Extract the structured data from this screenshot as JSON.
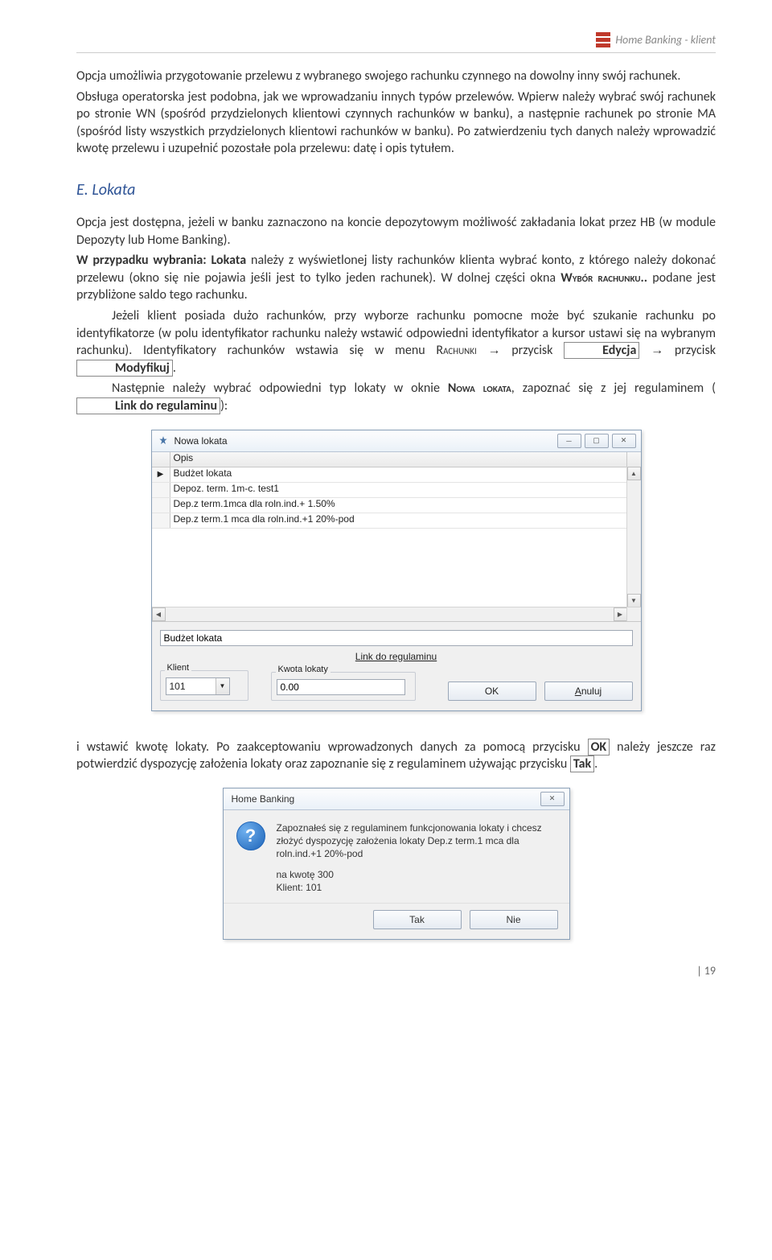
{
  "header": {
    "title": "Home Banking - klient"
  },
  "para1": "Opcja umożliwia przygotowanie przelewu z wybranego swojego rachunku czynnego na dowolny inny swój rachunek.",
  "para2": "Obsługa operatorska jest podobna, jak we wprowadzaniu innych typów przelewów. Wpierw należy wybrać swój rachunek po stronie WN (spośród przydzielonych klientowi czynnych rachunków w banku), a następnie rachunek po stronie MA (spośród listy wszystkich przydzielonych klientowi rachunków w banku). Po zatwierdzeniu tych danych należy wprowadzić kwotę przelewu i uzupełnić pozostałe pola przelewu: datę i opis tytułem.",
  "section_e": "E.   Lokata",
  "lokata_p1": "Opcja jest dostępna, jeżeli w banku zaznaczono na koncie depozytowym możliwość zakładania lokat przez HB (w module Depozyty lub Home Banking).",
  "lokata_p2a": "W przypadku wybrania: Lokata",
  "lokata_p2b": " należy z wyświetlonej listy rachunków klienta wybrać konto, z którego należy dokonać przelewu (okno się nie pojawia jeśli jest to tylko jeden rachunek). W dolnej części okna ",
  "lokata_p2c": "Wybór rachunku..",
  "lokata_p2d": " podane jest przybliżone saldo tego rachunku.",
  "lokata_p3": "Jeżeli klient posiada dużo rachunków, przy wyborze rachunku pomocne może być szukanie rachunku po identyfikatorze (w polu identyfikator rachunku należy wstawić odpowiedni identyfikator a kursor ustawi się na wybranym rachunku).  Identyfikatory rachunków wstawia się w menu ",
  "lokata_p3_sc": "Rachunki",
  "lokata_p3_arrow": "→",
  "lokata_p3_btn1": "Edycja",
  "lokata_p3_mid": " przycisk ",
  "lokata_p3_btn2": "Modyfikuj",
  "lokata_p4a": "Następnie należy wybrać odpowiedni typ lokaty w oknie ",
  "lokata_p4b": "Nowa lokata",
  "lokata_p4c": ", zapoznać się z jej regulaminem (",
  "lokata_p4_link": "Link do regulaminu",
  "lokata_p4d": "):",
  "window": {
    "title": "Nowa lokata",
    "col_opis": "Opis",
    "rows": [
      "Budżet lokata",
      "Depoz. term. 1m-c. test1",
      "Dep.z term.1mca dla roln.ind.+ 1.50%",
      "Dep.z term.1 mca dla roln.ind.+1 20%-pod"
    ],
    "selected_text": "Budżet lokata",
    "link": "Link do regulaminu",
    "klient_label": "Klient",
    "klient_value": "101",
    "kwota_label": "Kwota lokaty",
    "kwota_value": "0.00",
    "ok": "OK",
    "cancel": "Anuluj"
  },
  "after1a": "i wstawić kwotę lokaty. Po zaakceptowaniu wprowadzonych danych za pomocą przycisku ",
  "after1_btn": "OK",
  "after1b": " należy jeszcze raz potwierdzić dyspozycję założenia lokaty oraz zapoznanie się z regulaminem używając przycisku ",
  "after1_btn2": "Tak",
  "msgbox": {
    "title": "Home Banking",
    "line1": "Zapoznałeś się z regulaminem funkcjonowania lokaty i chcesz złożyć dyspozycję założenia lokaty Dep.z term.1 mca dla roln.ind.+1 20%-pod",
    "line2": "na kwotę 300",
    "line3": "Klient: 101",
    "yes": "Tak",
    "no": "Nie"
  },
  "page_num": "| 19"
}
